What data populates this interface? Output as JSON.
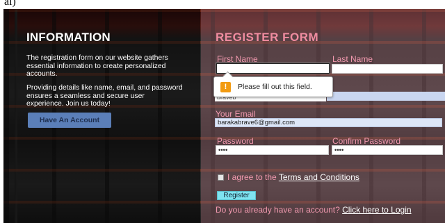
{
  "top_crop_text": "al)",
  "info": {
    "title": "INFORMATION",
    "paragraph_1": "The registration form on our website gathers essential information to create personalized accounts.",
    "paragraph_2": "Providing details like name, email, and password ensures a seamless and secure user experience. Join us today!",
    "have_account_button": "Have An Account"
  },
  "register": {
    "title": "REGISTER FORM",
    "first_name_label": "First Name",
    "last_name_label": "Last Name",
    "first_name_value": "",
    "last_name_value": "",
    "partial_lastname_value": "braveb",
    "email_label": "Your Email",
    "email_value": "barakabrave6@gmail.com",
    "password_label": "Password",
    "password_value": "••••",
    "confirm_password_label": "Confirm Password",
    "confirm_password_value": "••••",
    "agree_prefix": "I agree to the ",
    "terms_link": "Terms and Conditions",
    "register_button": "Register",
    "login_prompt": "Do you already have an account?",
    "login_link": "Click here to Login"
  },
  "tooltip": {
    "icon": "warning-icon",
    "message": "Please fill out this field."
  },
  "colors": {
    "accent_pink": "#f08ca0",
    "button_blue": "#5b7fb8",
    "register_cyan": "#7fe3f0",
    "warning_orange": "#f29b12"
  }
}
